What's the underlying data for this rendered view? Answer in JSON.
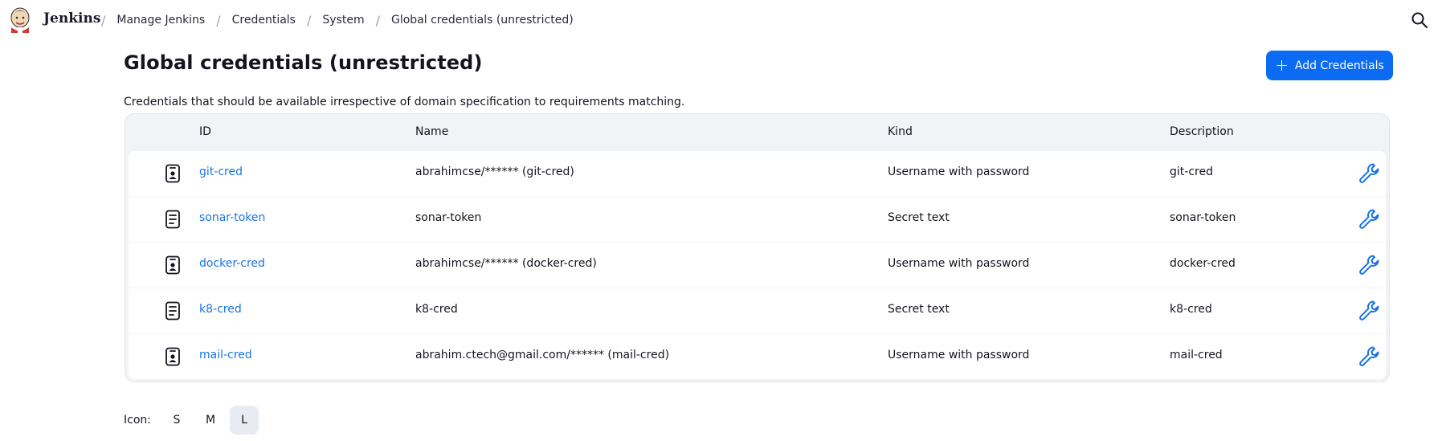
{
  "header": {
    "brand": "Jenkins",
    "breadcrumbs": [
      {
        "label": "Manage Jenkins"
      },
      {
        "label": "Credentials"
      },
      {
        "label": "System"
      },
      {
        "label": "Global credentials (unrestricted)"
      }
    ]
  },
  "page": {
    "title": "Global credentials (unrestricted)",
    "add_button": "Add Credentials",
    "description": "Credentials that should be available irrespective of domain specification to requirements matching."
  },
  "table": {
    "columns": {
      "id": "ID",
      "name": "Name",
      "kind": "Kind",
      "description": "Description"
    },
    "rows": [
      {
        "icon": "username-password-icon",
        "id": "git-cred",
        "name": "abrahimcse/****** (git-cred)",
        "kind": "Username with password",
        "description": "git-cred"
      },
      {
        "icon": "secret-text-icon",
        "id": "sonar-token",
        "name": "sonar-token",
        "kind": "Secret text",
        "description": "sonar-token"
      },
      {
        "icon": "username-password-icon",
        "id": "docker-cred",
        "name": "abrahimcse/****** (docker-cred)",
        "kind": "Username with password",
        "description": "docker-cred"
      },
      {
        "icon": "secret-text-icon",
        "id": "k8-cred",
        "name": "k8-cred",
        "kind": "Secret text",
        "description": "k8-cred"
      },
      {
        "icon": "username-password-icon",
        "id": "mail-cred",
        "name": "abrahim.ctech@gmail.com/****** (mail-cred)",
        "kind": "Username with password",
        "description": "mail-cred"
      }
    ]
  },
  "icon_size": {
    "label": "Icon:",
    "options": [
      "S",
      "M",
      "L"
    ],
    "selected": "L"
  },
  "colors": {
    "accent": "#0b6bf2",
    "link": "#1a73e8"
  }
}
